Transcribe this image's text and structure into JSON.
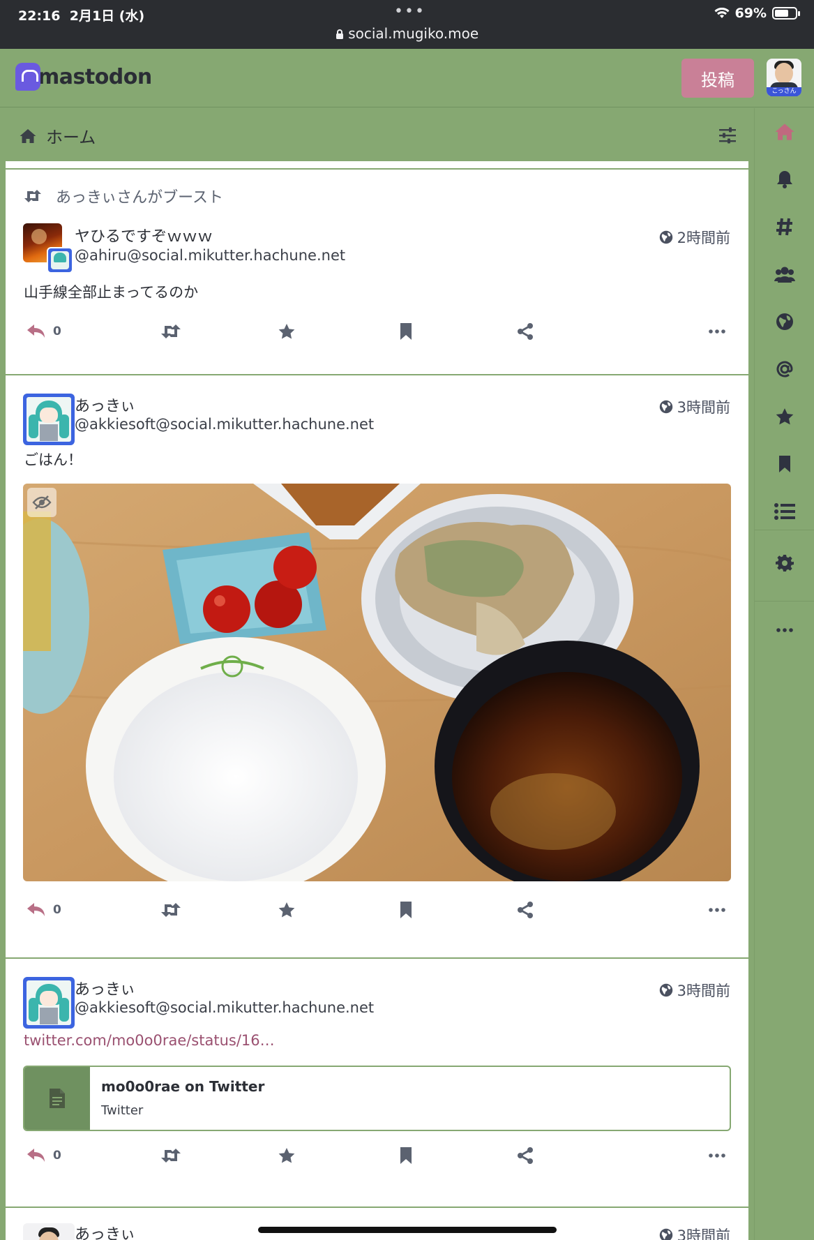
{
  "status_bar": {
    "time": "22:16",
    "date": "2月1日 (水)",
    "url": "social.mugiko.moe",
    "battery": "69%",
    "battery_level": 0.69
  },
  "app": {
    "logo_text": "mastodon",
    "post_button": "投稿",
    "avatar_tag": "こっさん"
  },
  "column": {
    "title": "ホーム"
  },
  "nav": [
    "home-icon",
    "bell-icon",
    "hashtag-icon",
    "users-icon",
    "globe-icon",
    "at-icon",
    "star-icon",
    "bookmark-icon",
    "list-icon",
    "gear-icon",
    "ellipsis-icon"
  ],
  "statuses": [
    {
      "boost_text": "あっきぃさんがブースト",
      "display_name": "ヤひるですぞｗｗｗ",
      "acct": "@ahiru@social.mikutter.hachune.net",
      "time": "2時間前",
      "content": "山手線全部止まってるのか",
      "replies": "0"
    },
    {
      "display_name": "あっきぃ",
      "acct": "@akkiesoft@social.mikutter.hachune.net",
      "time": "3時間前",
      "content": "ごはん！",
      "replies": "0"
    },
    {
      "display_name": "あっきぃ",
      "acct": "@akkiesoft@social.mikutter.hachune.net",
      "time": "3時間前",
      "link": "twitter.com/mo0o0rae/status/16…",
      "card_title": "mo0o0rae on Twitter",
      "card_provider": "Twitter",
      "replies": "0"
    },
    {
      "display_name": "あっきぃ",
      "time": "3時間前"
    }
  ]
}
